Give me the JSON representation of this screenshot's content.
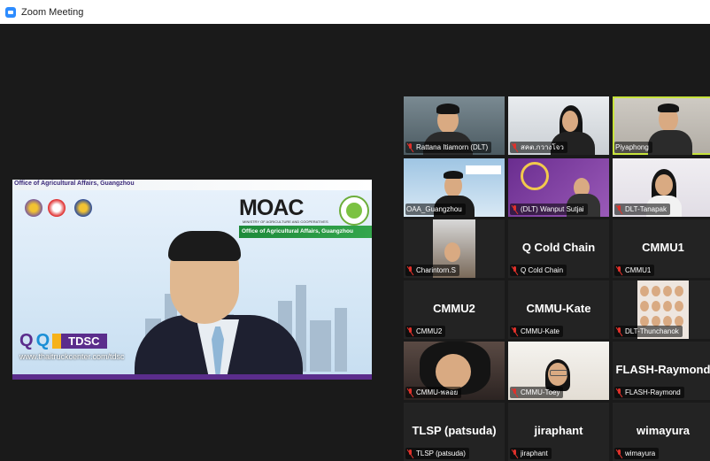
{
  "window": {
    "title": "Zoom Meeting",
    "icon": "zoom-app-icon"
  },
  "speaker": {
    "slide_header": "Office of Agricultural Affairs, Guangzhou",
    "moac_logo_text": "MOAC",
    "moac_subtitle": "MINISTRY OF AGRICULTURE AND COOPERATIVES",
    "oaa_banner": "Office of Agricultural Affairs, Guangzhou",
    "tdsc_label": "TDSC",
    "website": "www.thaitruckcenter.com/tdsc"
  },
  "participants": [
    {
      "name": "Rattana Itiamorn (DLT)",
      "muted": true,
      "video": true,
      "active": false
    },
    {
      "name": "สคต.กวางโจว",
      "muted": true,
      "video": true,
      "active": false
    },
    {
      "name": "Piyaphong",
      "muted": false,
      "video": true,
      "active": true
    },
    {
      "name": "OAA_Guangzhou",
      "muted": false,
      "video": true,
      "active": false
    },
    {
      "name": "(DLT) Wanput Sutjai",
      "muted": true,
      "video": true,
      "active": false
    },
    {
      "name": "DLT-Tanapak",
      "muted": true,
      "video": true,
      "active": false
    },
    {
      "name": "Charintorn.S",
      "muted": true,
      "video": true,
      "active": false
    },
    {
      "name": "Q Cold Chain",
      "muted": true,
      "video": false,
      "active": false
    },
    {
      "name": "CMMU1",
      "muted": true,
      "video": false,
      "active": false
    },
    {
      "name": "CMMU2",
      "muted": true,
      "video": false,
      "active": false
    },
    {
      "name": "CMMU-Kate",
      "muted": true,
      "video": false,
      "active": false
    },
    {
      "name": "DLT-Thunchanok",
      "muted": true,
      "video": true,
      "active": false
    },
    {
      "name": "CMMU-พลอย",
      "muted": true,
      "video": true,
      "active": false
    },
    {
      "name": "CMMU-Toey",
      "muted": true,
      "video": true,
      "active": false
    },
    {
      "name": "FLASH-Raymond",
      "muted": true,
      "video": false,
      "active": false
    },
    {
      "name": "TLSP (patsuda)",
      "muted": true,
      "video": false,
      "active": false
    },
    {
      "name": "jiraphant",
      "muted": true,
      "video": false,
      "active": false
    },
    {
      "name": "wimayura",
      "muted": true,
      "video": false,
      "active": false
    }
  ],
  "colors": {
    "active_speaker_border": "#c7e33c",
    "muted_icon": "#e0312b",
    "background": "#1a1a1a"
  }
}
